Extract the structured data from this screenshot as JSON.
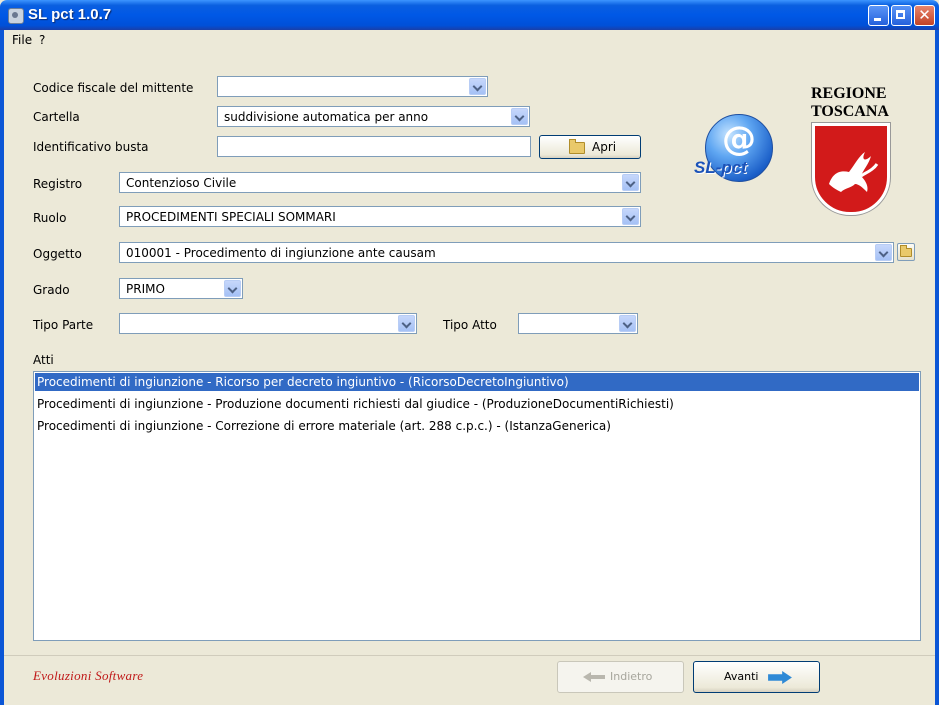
{
  "window": {
    "title": "SL pct 1.0.7"
  },
  "menu": [
    "File",
    "?"
  ],
  "form": {
    "codice_fiscale_label": "Codice fiscale del mittente",
    "codice_fiscale_value": "",
    "cartella_label": "Cartella",
    "cartella_value": "suddivisione automatica per anno",
    "identificativo_label": "Identificativo busta",
    "identificativo_value": "",
    "apri_button": "Apri",
    "registro_label": "Registro",
    "registro_value": "Contenzioso Civile",
    "ruolo_label": "Ruolo",
    "ruolo_value": "PROCEDIMENTI SPECIALI SOMMARI",
    "oggetto_label": "Oggetto",
    "oggetto_value": "010001 - Procedimento di ingiunzione ante causam",
    "grado_label": "Grado",
    "grado_value": "PRIMO",
    "tipo_parte_label": "Tipo Parte",
    "tipo_parte_value": "",
    "tipo_atto_label": "Tipo Atto",
    "tipo_atto_value": ""
  },
  "atti": {
    "label": "Atti",
    "items": [
      "Procedimenti di ingiunzione - Ricorso per decreto ingiuntivo - (RicorsoDecretoIngiuntivo)",
      "Procedimenti di ingiunzione - Produzione documenti richiesti dal giudice - (ProduzioneDocumentiRichiesti)",
      "Procedimenti di ingiunzione - Correzione di errore materiale (art. 288 c.p.c.) - (IstanzaGenerica)"
    ],
    "selected_index": 0
  },
  "logos": {
    "app": "SL-pct",
    "region_line1": "REGIONE",
    "region_line2": "TOSCANA"
  },
  "footer": {
    "brand": "Evoluzioni Software",
    "back_button": "Indietro",
    "next_button": "Avanti"
  },
  "colors": {
    "selection": "#316ac5",
    "title_bar": "#0058e6",
    "brand_red": "#c01818"
  }
}
